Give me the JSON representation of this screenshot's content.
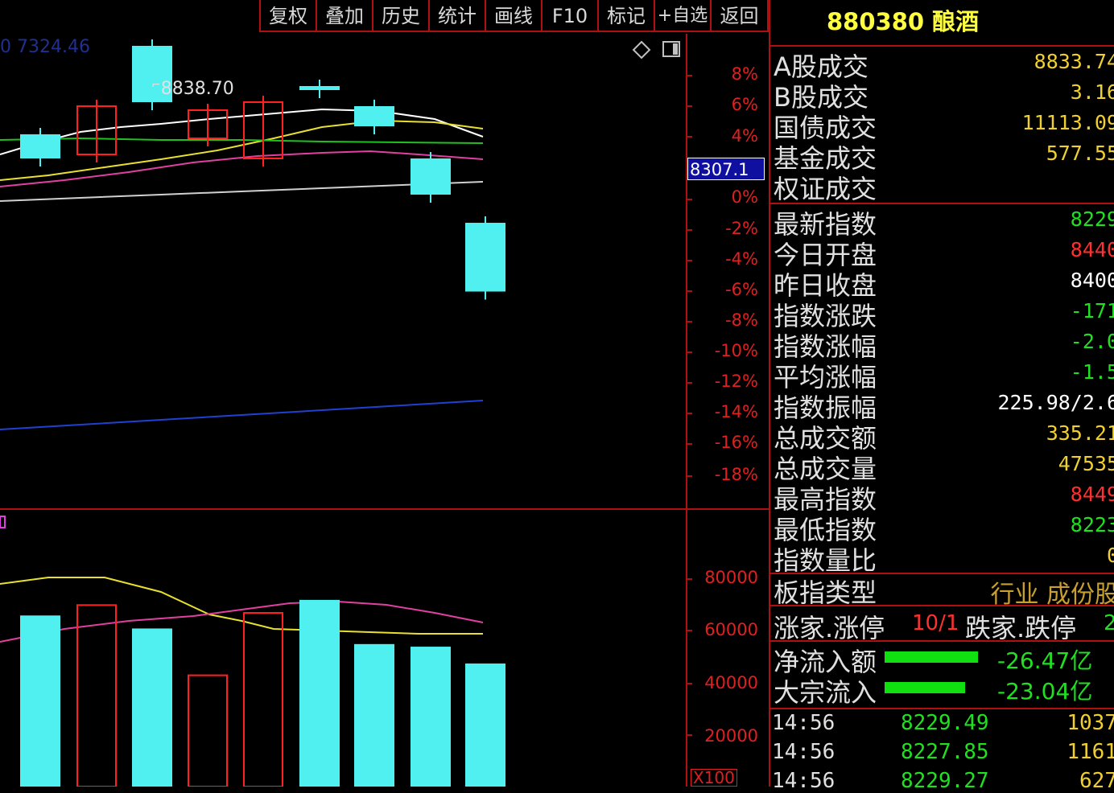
{
  "toolbar": {
    "buttons": [
      "复权",
      "叠加",
      "历史",
      "统计",
      "画线",
      "F10",
      "标记",
      "+自选",
      "返回"
    ]
  },
  "chart": {
    "indicator_label": "0  7324.46",
    "high_label": "8838.70",
    "price_cursor": "8307.1",
    "pct_axis": [
      "8%",
      "6%",
      "4%",
      "0%",
      "-2%",
      "-4%",
      "-6%",
      "-8%",
      "-10%",
      "-12%",
      "-14%",
      "-16%",
      "-18%"
    ],
    "vol_axis": [
      "80000",
      "60000",
      "40000",
      "20000"
    ],
    "vol_unit": "X100"
  },
  "chart_data": {
    "type": "bar",
    "candles": [
      {
        "open": 8560,
        "close": 8620,
        "color": "cyan"
      },
      {
        "open": 8570,
        "close": 8690,
        "color": "red"
      },
      {
        "open": 8840,
        "close": 8700,
        "color": "cyan"
      },
      {
        "open": 8610,
        "close": 8680,
        "color": "red"
      },
      {
        "open": 8560,
        "close": 8700,
        "color": "red"
      },
      {
        "open": 8740,
        "close": 8730,
        "color": "cyan"
      },
      {
        "open": 8690,
        "close": 8640,
        "color": "cyan"
      },
      {
        "open": 8560,
        "close": 8470,
        "color": "cyan"
      },
      {
        "open": 8400,
        "close": 8229,
        "color": "cyan"
      }
    ],
    "volumes": [
      {
        "value": 66000,
        "color": "cyan"
      },
      {
        "value": 70000,
        "color": "red"
      },
      {
        "value": 61000,
        "color": "cyan"
      },
      {
        "value": 43000,
        "color": "red"
      },
      {
        "value": 67000,
        "color": "red"
      },
      {
        "value": 72000,
        "color": "cyan"
      },
      {
        "value": 55000,
        "color": "cyan"
      },
      {
        "value": 54000,
        "color": "cyan"
      },
      {
        "value": 47535,
        "color": "cyan"
      }
    ]
  },
  "panel": {
    "title": "880380 酿酒",
    "rows": [
      {
        "label": "A股成交",
        "value": "8833.74",
        "color": "yellow"
      },
      {
        "label": "B股成交",
        "value": "3.16",
        "color": "yellow"
      },
      {
        "label": "国债成交",
        "value": "11113.09",
        "color": "yellow"
      },
      {
        "label": "基金成交",
        "value": "577.55",
        "color": "yellow"
      },
      {
        "label": "权证成交",
        "value": "",
        "color": "yellow"
      },
      {
        "label": "最新指数",
        "value": "8229",
        "color": "green"
      },
      {
        "label": "今日开盘",
        "value": "8440",
        "color": "red"
      },
      {
        "label": "昨日收盘",
        "value": "8400",
        "color": "white"
      },
      {
        "label": "指数涨跌",
        "value": "-171",
        "color": "green"
      },
      {
        "label": "指数涨幅",
        "value": "-2.0",
        "color": "green"
      },
      {
        "label": "平均涨幅",
        "value": "-1.5",
        "color": "green"
      },
      {
        "label": "指数振幅",
        "value": "225.98/2.6",
        "color": "white"
      },
      {
        "label": "总成交额",
        "value": "335.21",
        "color": "yellow"
      },
      {
        "label": "总成交量",
        "value": "47535",
        "color": "yellow"
      },
      {
        "label": "最高指数",
        "value": "8449",
        "color": "red"
      },
      {
        "label": "最低指数",
        "value": "8223",
        "color": "green"
      },
      {
        "label": "指数量比",
        "value": "0",
        "color": "yellow"
      }
    ],
    "board_type_label": "板指类型",
    "board_type_value": "行业 成份股",
    "updown": {
      "up_label": "涨家.涨停",
      "up_value": "10/1",
      "down_label": "跌家.跌停",
      "down_value": "2"
    },
    "flows": [
      {
        "label": "净流入额",
        "value": "-26.47亿"
      },
      {
        "label": "大宗流入",
        "value": "-23.04亿"
      }
    ],
    "ticks": [
      {
        "time": "14:56",
        "price": "8229.49",
        "vol": "1037"
      },
      {
        "time": "14:56",
        "price": "8227.85",
        "vol": "1161"
      },
      {
        "time": "14:56",
        "price": "8229.27",
        "vol": "627"
      }
    ]
  }
}
